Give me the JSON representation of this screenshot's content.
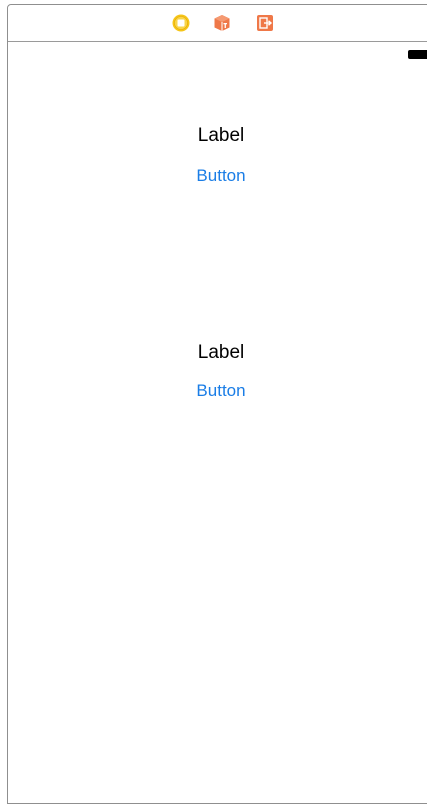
{
  "scene_dock": {
    "icons": [
      {
        "name": "view-controller-icon",
        "color": "#f5c518"
      },
      {
        "name": "first-responder-icon",
        "color": "#ef7848"
      },
      {
        "name": "exit-icon",
        "color": "#ef7848"
      }
    ]
  },
  "view": {
    "elements": [
      {
        "label": "Label",
        "button": "Button"
      },
      {
        "label": "Label",
        "button": "Button"
      }
    ]
  },
  "colors": {
    "button_tint": "#1a7de6",
    "label_text": "#000000",
    "frame_border": "#8f8f8f"
  }
}
